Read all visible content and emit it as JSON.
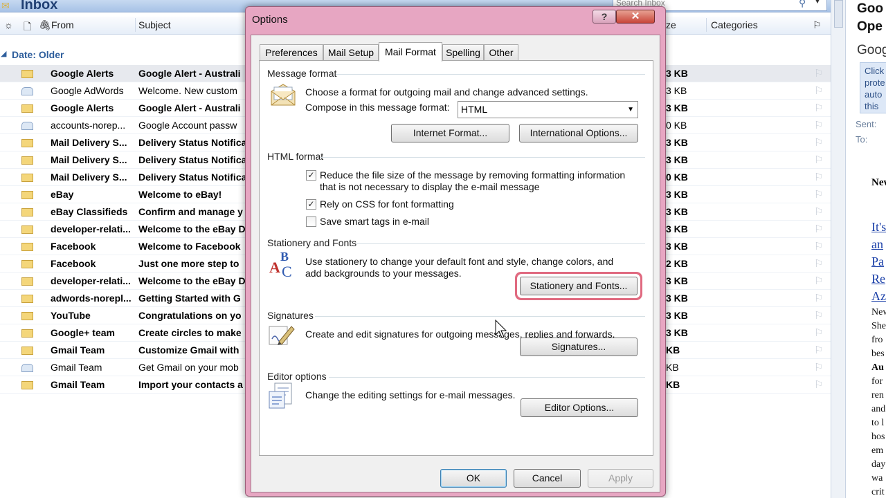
{
  "inbox": {
    "title": "Inbox",
    "search_placeholder": "Search Inbox",
    "columns": {
      "from": "From",
      "subject": "Subject",
      "size": "ze",
      "categories": "Categories"
    },
    "group_label": "Date: Older",
    "rows": [
      {
        "from": "Google Alerts",
        "subject": "Google Alert - Australi",
        "size": "3 KB",
        "unread": true,
        "selected": true
      },
      {
        "from": "Google AdWords",
        "subject": "Welcome. New custom",
        "size": "3 KB",
        "unread": false
      },
      {
        "from": "Google Alerts",
        "subject": "Google Alert - Australi",
        "size": "3 KB",
        "unread": true
      },
      {
        "from": "accounts-norep...",
        "subject": "Google Account passw",
        "size": "0 KB",
        "unread": false
      },
      {
        "from": "Mail Delivery S...",
        "subject": "Delivery Status Notifica",
        "size": "3 KB",
        "unread": true
      },
      {
        "from": "Mail Delivery S...",
        "subject": "Delivery Status Notifica",
        "size": "3 KB",
        "unread": true
      },
      {
        "from": "Mail Delivery S...",
        "subject": "Delivery Status Notifica",
        "size": "0 KB",
        "unread": true
      },
      {
        "from": "eBay",
        "subject": "Welcome to eBay!",
        "size": "3 KB",
        "unread": true
      },
      {
        "from": "eBay Classifieds",
        "subject": "Confirm and manage y",
        "size": "3 KB",
        "unread": true
      },
      {
        "from": "developer-relati...",
        "subject": "Welcome to the eBay D",
        "size": "3 KB",
        "unread": true
      },
      {
        "from": "Facebook",
        "subject": "Welcome to Facebook",
        "size": "3 KB",
        "unread": true
      },
      {
        "from": "Facebook",
        "subject": "Just one more step to",
        "size": "2 KB",
        "unread": true
      },
      {
        "from": "developer-relati...",
        "subject": "Welcome to the eBay D",
        "size": "3 KB",
        "unread": true
      },
      {
        "from": "adwords-norepl...",
        "subject": "Getting Started with G",
        "size": "3 KB",
        "unread": true
      },
      {
        "from": "YouTube",
        "subject": "Congratulations on yo",
        "size": "3 KB",
        "unread": true
      },
      {
        "from": "Google+ team",
        "subject": "Create circles to make",
        "size": "3 KB",
        "unread": true
      },
      {
        "from": "Gmail Team",
        "subject": "Customize Gmail with",
        "size": "KB",
        "unread": true
      },
      {
        "from": "Gmail Team",
        "subject": "Get Gmail on your mob",
        "size": "KB",
        "unread": false
      },
      {
        "from": "Gmail Team",
        "subject": "Import your contacts a",
        "size": "KB",
        "unread": true
      }
    ]
  },
  "reading_pane": {
    "title_line1": "Goo",
    "title_line2": "Ope",
    "title_line3": "Goog",
    "info_lines": [
      "Click",
      "prote",
      "auto",
      "this"
    ],
    "sent_label": "Sent:",
    "to_label": "To:",
    "body_heading": "New",
    "links": [
      "It's",
      "an",
      "Pa",
      "Re",
      "Az"
    ],
    "body_lines": [
      "New",
      "She",
      "fro",
      "bes",
      "Au",
      "for",
      "ren",
      "and",
      "to l",
      "hos",
      "em",
      "day",
      "wa",
      "crit"
    ]
  },
  "dialog": {
    "title": "Options",
    "help_label": "?",
    "close_label": "✕",
    "tabs": [
      "Preferences",
      "Mail Setup",
      "Mail Format",
      "Spelling",
      "Other"
    ],
    "active_tab": "Mail Format",
    "message_format": {
      "label": "Message format",
      "description": "Choose a format for outgoing mail and change advanced settings.",
      "compose_label": "Compose in this message format:",
      "compose_value": "HTML",
      "internet_format_button": "Internet Format...",
      "international_options_button": "International Options..."
    },
    "html_format": {
      "label": "HTML format",
      "reduce_size_line1": "Reduce the file size of the message by removing formatting information",
      "reduce_size_line2": "that is not necessary to display the e-mail message",
      "reduce_size_checked": true,
      "rely_css": "Rely on CSS for font formatting",
      "rely_css_checked": true,
      "smart_tags": "Save smart tags in e-mail",
      "smart_tags_checked": false
    },
    "stationery": {
      "label": "Stationery and Fonts",
      "description_line1": "Use stationery to change your default font and style, change colors, and",
      "description_line2": "add backgrounds to your messages.",
      "button": "Stationery and Fonts..."
    },
    "signatures": {
      "label": "Signatures",
      "description": "Create and edit signatures for outgoing messages, replies and forwards.",
      "button": "Signatures..."
    },
    "editor": {
      "label": "Editor options",
      "description": "Change the editing settings for e-mail messages.",
      "button": "Editor Options..."
    },
    "ok_button": "OK",
    "cancel_button": "Cancel",
    "apply_button": "Apply"
  },
  "colors": {
    "dialog_frame": "#e7a6c2",
    "highlight": "#e06a80",
    "inbox_group": "#2e5e9c"
  }
}
